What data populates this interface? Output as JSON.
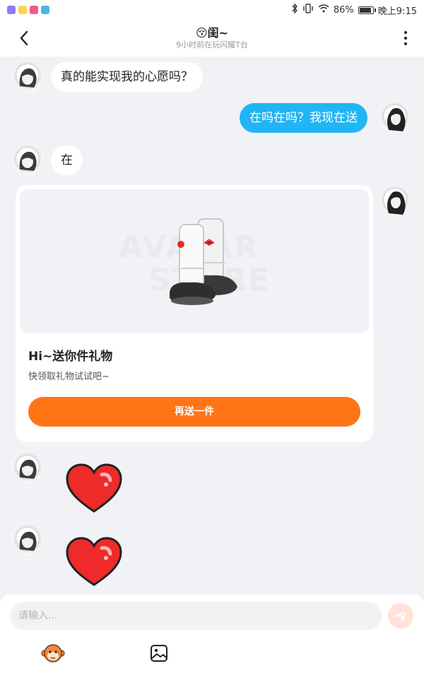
{
  "status_bar": {
    "battery": "86%",
    "time": "晚上9:15"
  },
  "header": {
    "title": "😚闺~",
    "subtitle": "9小时前在玩闪耀T台"
  },
  "messages": [
    {
      "side": "left",
      "text": "真的能实现我的心愿吗？"
    },
    {
      "side": "right",
      "text": "在吗在吗？我现在送"
    },
    {
      "side": "left",
      "text": "在"
    }
  ],
  "gift_card": {
    "watermark_line1": "AVATAR",
    "watermark_line2": "STORE",
    "title": "Hi~送你件礼物",
    "subtitle": "快领取礼物试试吧~",
    "button_label": "再送一件"
  },
  "input": {
    "placeholder": "请输入..."
  },
  "colors": {
    "accent_orange": "#ff7415",
    "bubble_blue": "#21b5f5",
    "background": "#f1f2f6"
  },
  "icons": {
    "back": "chevron-left-icon",
    "more": "more-vertical-icon",
    "send": "send-icon",
    "emoji": "monkey-emoji-icon",
    "image": "image-icon"
  }
}
